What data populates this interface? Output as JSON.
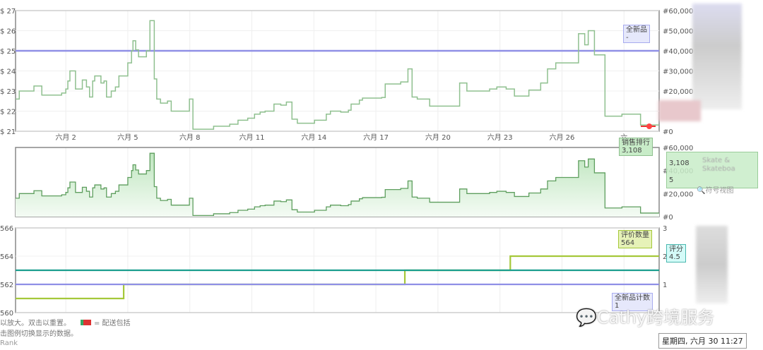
{
  "chart_data": [
    {
      "type": "line",
      "x_unit": "June day",
      "x_ticks": [
        {
          "v": 2,
          "label": "六月 2"
        },
        {
          "v": 5,
          "label": "六月 5"
        },
        {
          "v": 8,
          "label": "六月 8"
        },
        {
          "v": 11,
          "label": "六月 11"
        },
        {
          "v": 14,
          "label": "六月 14"
        },
        {
          "v": 17,
          "label": "六月 17"
        },
        {
          "v": 20,
          "label": "六月 20"
        },
        {
          "v": 23,
          "label": "六月 23"
        },
        {
          "v": 26,
          "label": "六月 26"
        },
        {
          "v": 29,
          "label": "六"
        }
      ],
      "xlim": [
        -0.43,
        30.7
      ],
      "y_left": {
        "ticks": [
          "$ 21",
          "$ 22",
          "$ 23",
          "$ 24",
          "$ 25",
          "$ 26",
          "$ 27"
        ],
        "lim": [
          21,
          27
        ]
      },
      "y_right": {
        "ticks": [
          "#0",
          "#10,000",
          "#20,000",
          "#30,000",
          "#40,000",
          "#50,000",
          "#60,000"
        ],
        "lim": [
          0,
          60000
        ]
      },
      "grid": true,
      "series": [
        {
          "name": "全新品",
          "axis": "left",
          "color": "#8f8fe6",
          "value_label": "-",
          "points": [
            [
              -0.43,
              25
            ],
            [
              30.7,
              25
            ]
          ]
        },
        {
          "name": "销售排行",
          "axis": "right",
          "color": "#8fc08f",
          "value_label": "3,108",
          "points": [
            [
              -0.43,
              16000
            ],
            [
              -0.25,
              20000
            ],
            [
              0.46,
              22500
            ],
            [
              0.84,
              18000
            ],
            [
              1.8,
              19000
            ],
            [
              2.0,
              21000
            ],
            [
              2.1,
              25000
            ],
            [
              2.2,
              30000
            ],
            [
              2.47,
              21000
            ],
            [
              2.8,
              25500
            ],
            [
              3.0,
              22000
            ],
            [
              3.15,
              17000
            ],
            [
              3.3,
              25000
            ],
            [
              3.4,
              27500
            ],
            [
              3.7,
              24000
            ],
            [
              3.85,
              25000
            ],
            [
              3.97,
              17000
            ],
            [
              4.2,
              20000
            ],
            [
              4.4,
              22000
            ],
            [
              4.57,
              27500
            ],
            [
              5.0,
              34000
            ],
            [
              5.18,
              40000
            ],
            [
              5.25,
              45000
            ],
            [
              5.38,
              40500
            ],
            [
              5.52,
              37000
            ],
            [
              5.9,
              40000
            ],
            [
              6.07,
              55000
            ],
            [
              6.28,
              26000
            ],
            [
              6.4,
              16000
            ],
            [
              6.58,
              14000
            ],
            [
              6.92,
              15000
            ],
            [
              7.1,
              10000
            ],
            [
              7.98,
              16000
            ],
            [
              8.15,
              1000
            ],
            [
              9.15,
              2500
            ],
            [
              9.93,
              3500
            ],
            [
              10.33,
              5500
            ],
            [
              10.8,
              6500
            ],
            [
              11.13,
              8500
            ],
            [
              11.4,
              9500
            ],
            [
              11.64,
              10000
            ],
            [
              12.07,
              13500
            ],
            [
              12.4,
              13000
            ],
            [
              12.67,
              14500
            ],
            [
              12.94,
              6000
            ],
            [
              13.2,
              4000
            ],
            [
              14.03,
              5500
            ],
            [
              14.6,
              8500
            ],
            [
              14.8,
              10000
            ],
            [
              15.3,
              9500
            ],
            [
              15.67,
              10500
            ],
            [
              15.8,
              13500
            ],
            [
              16.2,
              15500
            ],
            [
              16.35,
              16500
            ],
            [
              17.28,
              16800
            ],
            [
              17.45,
              23500
            ],
            [
              18.2,
              24500
            ],
            [
              18.55,
              31000
            ],
            [
              18.75,
              17000
            ],
            [
              19.0,
              16000
            ],
            [
              19.6,
              12500
            ],
            [
              21.05,
              24000
            ],
            [
              21.4,
              20000
            ],
            [
              22.5,
              21000
            ],
            [
              22.85,
              22000
            ],
            [
              23.3,
              21000
            ],
            [
              23.7,
              17500
            ],
            [
              24.4,
              20500
            ],
            [
              24.97,
              24000
            ],
            [
              25.3,
              31000
            ],
            [
              25.7,
              34000
            ],
            [
              26.8,
              48500
            ],
            [
              27.1,
              43000
            ],
            [
              27.27,
              50000
            ],
            [
              27.57,
              38000
            ],
            [
              28.08,
              7500
            ],
            [
              28.9,
              8500
            ],
            [
              29.8,
              3108
            ],
            [
              30.7,
              3108
            ]
          ]
        }
      ]
    },
    {
      "type": "area",
      "y_right": {
        "ticks": [
          "#0",
          "#20,000",
          "#40,000",
          "#60,000"
        ],
        "lim": [
          0,
          60000
        ]
      },
      "series": [
        {
          "name": "销售排行",
          "color": "#5e9e5e",
          "fill": "#d8f0d8",
          "ref": "same as chart 1 sales rank"
        }
      ]
    },
    {
      "type": "line",
      "y_left": {
        "ticks": [
          "560",
          "562",
          "564",
          "566"
        ],
        "lim": [
          560,
          566
        ]
      },
      "y_right": {
        "ticks": [
          "1",
          "2",
          "3"
        ],
        "lim": [
          0,
          3
        ]
      },
      "series": [
        {
          "name": "评价数量",
          "axis": "left",
          "color": "#a5c83a",
          "value_label": "564",
          "points": [
            [
              -0.43,
              561
            ],
            [
              4.8,
              561
            ],
            [
              4.8,
              562
            ],
            [
              18.4,
              562
            ],
            [
              18.4,
              563
            ],
            [
              23.5,
              563
            ],
            [
              23.5,
              564
            ],
            [
              30.7,
              564
            ]
          ]
        },
        {
          "name": "评分",
          "axis": "left",
          "color": "#1a9e8e",
          "value_label": "4.5",
          "points": [
            [
              -0.43,
              563
            ],
            [
              30.7,
              563
            ]
          ]
        },
        {
          "name": "全新品计数",
          "axis": "right",
          "color": "#8f8fe6",
          "value_label": "1",
          "points": [
            [
              -0.43,
              1
            ],
            [
              30.7,
              1
            ]
          ]
        }
      ]
    }
  ],
  "tooltip": {
    "rank": "3,108",
    "category": "Skate & Skateboa",
    "count": "5",
    "link": "符号视图",
    "date": "星期四, 六月 30 11:27"
  },
  "footer": {
    "line1": "以放大。双击以重置。",
    "shipping": "= 配送包括",
    "line2": "击图例切换显示的数据。",
    "line3": "Rank"
  },
  "watermark": "Cathy跨境服务"
}
